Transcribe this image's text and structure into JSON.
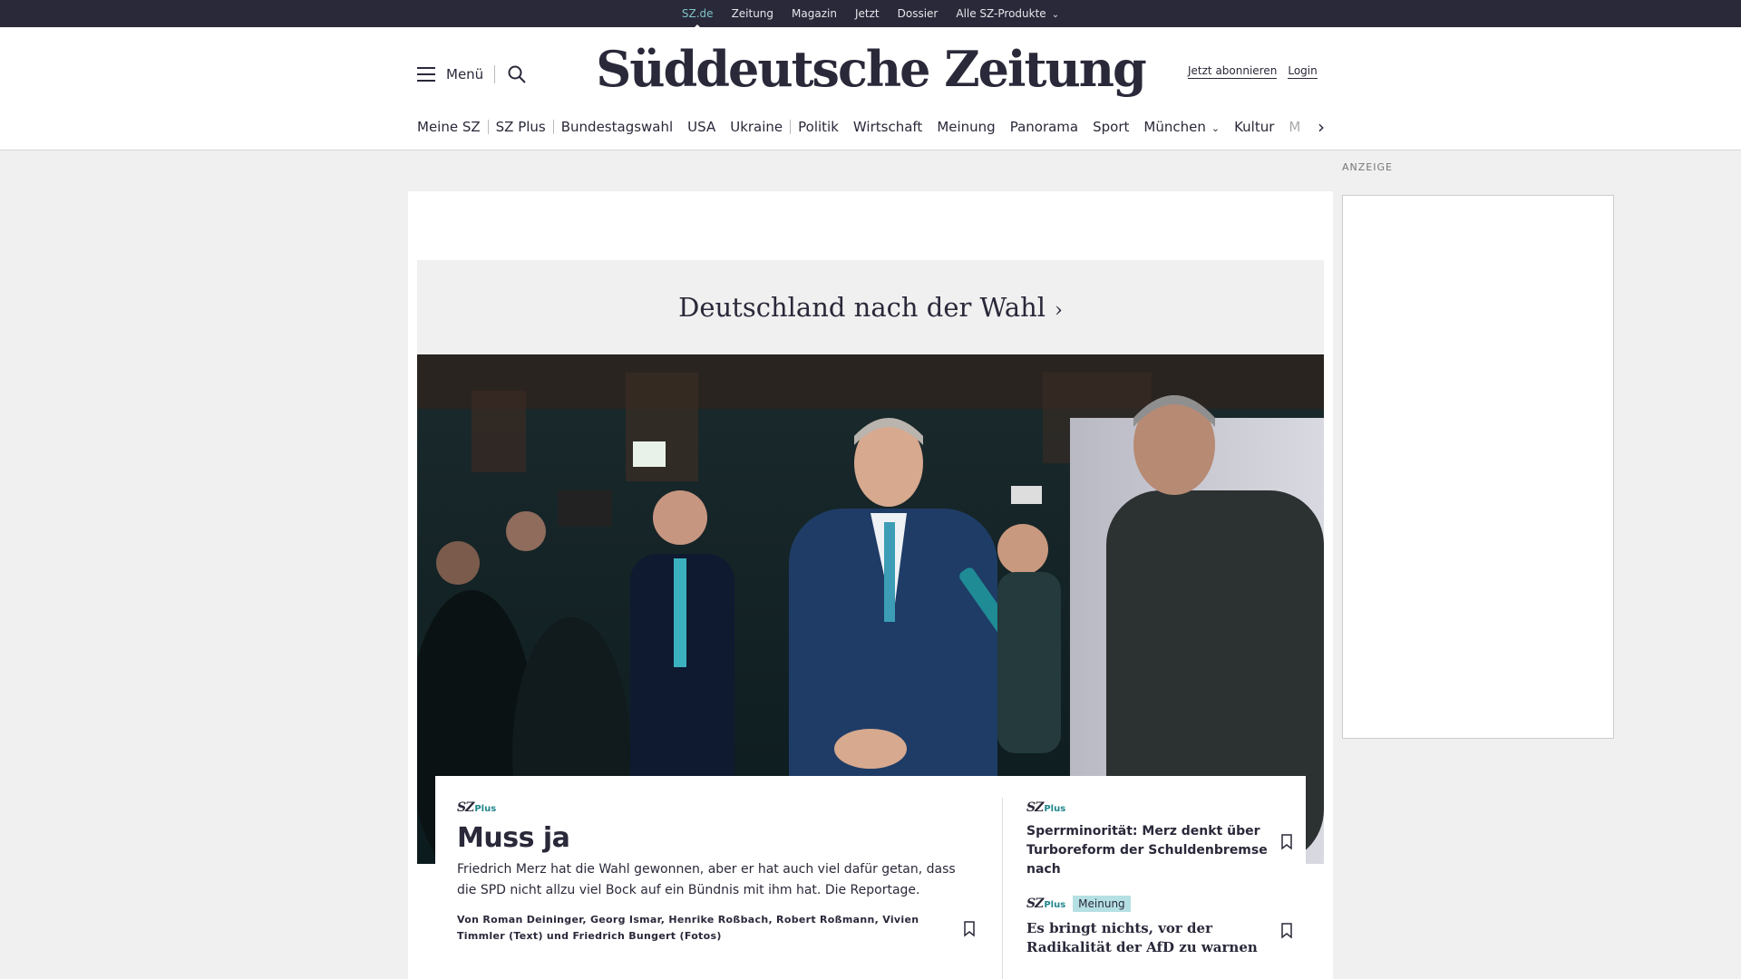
{
  "topbar": {
    "items": [
      "SZ.de",
      "Zeitung",
      "Magazin",
      "Jetzt",
      "Dossier",
      "Alle SZ-Produkte"
    ]
  },
  "header": {
    "menu_label": "Menü",
    "logo": "Süddeutsche Zeitung",
    "subscribe": "Jetzt abonnieren",
    "login": "Login"
  },
  "nav": {
    "items": [
      "Meine SZ",
      "SZ Plus",
      "Bundestagswahl",
      "USA",
      "Ukraine",
      "Politik",
      "Wirtschaft",
      "Meinung",
      "Panorama",
      "Sport",
      "München",
      "Kultur",
      "M"
    ]
  },
  "section": {
    "title": "Deutschland nach der Wahl",
    "arrow": "›"
  },
  "lead": {
    "brand_sz": "SZ",
    "brand_plus": "Plus",
    "headline": "Muss ja",
    "teaser": "Friedrich Merz hat die Wahl gewonnen, aber er hat auch viel dafür getan, dass die SPD nicht allzu viel Bock auf ein Bündnis mit ihm hat. Die Reportage.",
    "byline": "Von Roman Deininger, Georg Ismar, Henrike Roßbach, Robert Roßmann, Vivien Timmler (Text) und Friedrich Bungert (Fotos)"
  },
  "side": [
    {
      "brand_sz": "SZ",
      "brand_plus": "Plus",
      "headline": "Sperrminorität: Merz denkt über Turboreform der Schuldenbremse nach"
    },
    {
      "brand_sz": "SZ",
      "brand_plus": "Plus",
      "badge": "Meinung",
      "headline": "Es bringt nichts, vor der Radikalität der AfD zu warnen"
    }
  ],
  "ad": {
    "label": "ANZEIGE"
  },
  "colors": {
    "topbar": "#29293a",
    "accent": "#20868c",
    "badge": "#b5e0e3"
  }
}
